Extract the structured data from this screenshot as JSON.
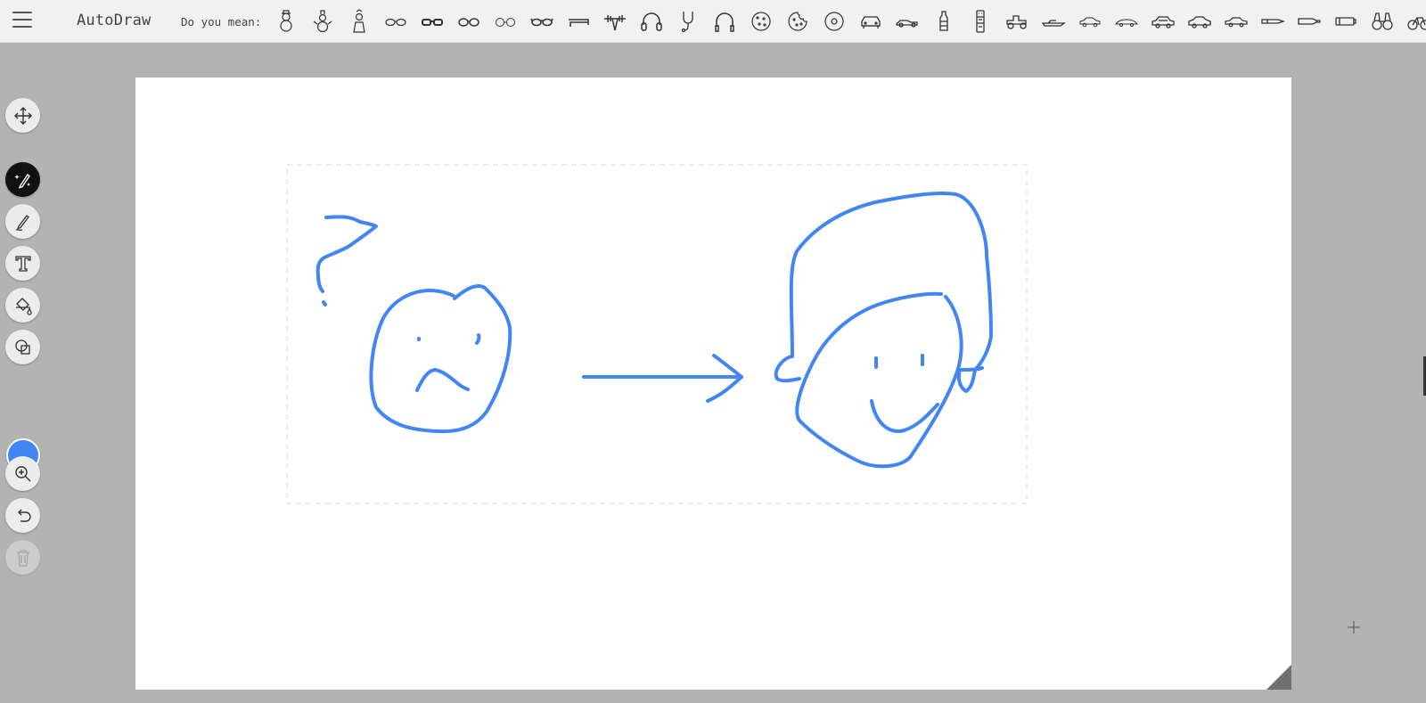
{
  "app": {
    "title": "AutoDraw",
    "accent_color": "#4285f4"
  },
  "topbar": {
    "menu_icon": "hamburger-menu-icon",
    "suggestion_label": "Do you mean:",
    "suggestions": [
      "snowman-icon",
      "snowman-hat-icon",
      "snowman-scarf-icon",
      "glasses-round-icon",
      "glasses-thick-icon",
      "glasses-classic-icon",
      "glasses-thin-icon",
      "glasses-dark-icon",
      "stapler-icon",
      "barbell-icon",
      "headphones-icon",
      "stethoscope-icon",
      "headphones-band-icon",
      "cookie-icon",
      "cookie-bitten-icon",
      "donut-icon",
      "car-front-icon",
      "racecar-icon",
      "bottle-icon",
      "totem-icon",
      "tractor-icon",
      "speedboat-icon",
      "car-outline-icon",
      "car-sleek-icon",
      "sedan-icon",
      "coupe-icon",
      "taxi-icon",
      "pen-icon",
      "marker-icon",
      "battery-icon",
      "binoculars-icon",
      "bicycle-icon"
    ]
  },
  "tools": [
    {
      "name": "move-tool",
      "icon": "move-arrows-icon",
      "active": false
    },
    {
      "name": "autodraw-tool",
      "icon": "autodraw-sparkle-pen-icon",
      "active": true
    },
    {
      "name": "draw-tool",
      "icon": "pencil-icon",
      "active": false
    },
    {
      "name": "type-tool",
      "icon": "text-icon",
      "active": false
    },
    {
      "name": "fill-tool",
      "icon": "paint-bucket-icon",
      "active": false
    },
    {
      "name": "shape-tool",
      "icon": "shapes-icon",
      "active": false
    },
    {
      "name": "zoom-tool",
      "icon": "zoom-in-icon",
      "active": false
    },
    {
      "name": "undo-tool",
      "icon": "undo-icon",
      "active": false
    },
    {
      "name": "delete-tool",
      "icon": "trash-icon",
      "active": false,
      "disabled": true
    }
  ],
  "color_picker": {
    "selected": "#4285f4"
  },
  "canvas": {
    "background": "#ffffff",
    "stroke_color": "#4285f4",
    "strokes": [
      "question-mark",
      "sad-face",
      "arrow",
      "smiling-face-with-hair"
    ]
  }
}
